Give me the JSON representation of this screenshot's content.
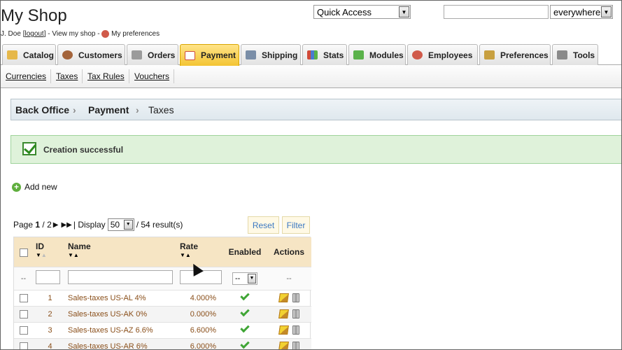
{
  "header": {
    "shop_title": "My Shop",
    "user_name": "J. Doe",
    "logout_label": "logout",
    "view_shop_label": "View my shop",
    "preferences_label": "My preferences",
    "quick_access_label": "Quick Access",
    "search_value": "",
    "scope_value": "everywhere"
  },
  "tabs": [
    {
      "label": "Catalog",
      "icon": "folder-icon",
      "color": "#e6b84a"
    },
    {
      "label": "Customers",
      "icon": "customer-icon",
      "color": "#a4643b"
    },
    {
      "label": "Orders",
      "icon": "cart-icon",
      "color": "#9b9b9b"
    },
    {
      "label": "Payment",
      "icon": "payment-icon",
      "color": "#d04a3a",
      "active": true
    },
    {
      "label": "Shipping",
      "icon": "truck-icon",
      "color": "#7a8ea8"
    },
    {
      "label": "Stats",
      "icon": "bar-chart-icon",
      "color": "#4a7bd1"
    },
    {
      "label": "Modules",
      "icon": "puzzle-icon",
      "color": "#5ab24a"
    },
    {
      "label": "Employees",
      "icon": "employee-icon",
      "color": "#d05a4a"
    },
    {
      "label": "Preferences",
      "icon": "preferences-icon",
      "color": "#c8a040"
    },
    {
      "label": "Tools",
      "icon": "wrench-icon",
      "color": "#8a8a8a"
    }
  ],
  "subnav": [
    "Currencies",
    "Taxes",
    "Tax Rules",
    "Vouchers"
  ],
  "breadcrumb": [
    "Back Office",
    "Payment",
    "Taxes"
  ],
  "success_message": "Creation successful",
  "add_new_label": "Add new",
  "pager": {
    "page_prefix": "Page",
    "current_page": "1",
    "total_pages": "2",
    "display_label": "Display",
    "per_page": "50",
    "results_text": "/ 54 result(s)"
  },
  "buttons": {
    "reset": "Reset",
    "filter": "Filter"
  },
  "table": {
    "columns": [
      "ID",
      "Name",
      "Rate",
      "Enabled",
      "Actions"
    ],
    "filter_placeholder": "--",
    "enabled_filter_value": "--",
    "actions_filter": "--",
    "rows": [
      {
        "id": "1",
        "name": "Sales-taxes US-AL 4%",
        "rate": "4.000%"
      },
      {
        "id": "2",
        "name": "Sales-taxes US-AK 0%",
        "rate": "0.000%"
      },
      {
        "id": "3",
        "name": "Sales-taxes US-AZ 6.6%",
        "rate": "6.600%"
      },
      {
        "id": "4",
        "name": "Sales-taxes US-AR 6%",
        "rate": "6.000%"
      }
    ]
  },
  "colors": {
    "active_tab": "#f3c433",
    "success_bg": "#dff2da",
    "header_bg": "#f6e5c4",
    "link_brown": "#8a4f1a",
    "button_text": "#3b79c2"
  }
}
